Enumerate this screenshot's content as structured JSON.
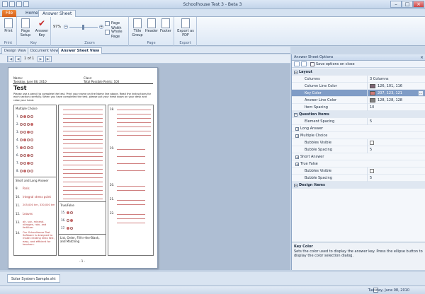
{
  "window": {
    "title": "Schoolhouse Test 3 - Beta 3"
  },
  "ribbon_tabs": [
    {
      "label": "File"
    },
    {
      "label": "Home"
    },
    {
      "label": "Answer Sheet"
    }
  ],
  "ribbon": {
    "groups": [
      {
        "label": "Print",
        "buttons": [
          "Print"
        ]
      },
      {
        "label": "Key",
        "buttons": [
          "Page Setup",
          "Answer Key"
        ]
      },
      {
        "label": "Zoom",
        "zoom_value": "97%",
        "buttons": [
          "Page Width",
          "Whole Page"
        ]
      },
      {
        "label": "Page",
        "buttons": [
          "Title Group",
          "Header",
          "Footer"
        ]
      },
      {
        "label": "Export",
        "buttons": [
          "Export as PDF"
        ]
      }
    ]
  },
  "view_tabs": [
    {
      "label": "Design View"
    },
    {
      "label": "Document View"
    },
    {
      "label": "Answer Sheet View"
    }
  ],
  "navigator": {
    "page_indicator": "1 of 1"
  },
  "paper": {
    "name_label": "Name:",
    "class_label": "Class:",
    "date": "Tuesday, June 08, 2010",
    "total_points": "Total Possible Points: 100",
    "title": "Test",
    "instructions": "Please use a pencil to complete the test. Print your name on the Name line above. Read the instructions for each section carefully. When you have completed the test, please put your head down on your desk and raise your hand.",
    "sections": {
      "multiple_choice": "Multiple Choice",
      "short_long": "Short and Long Answer",
      "true_false": "True/False",
      "list_order": "List, Order, Fill-in-the-Blank, and Matching"
    },
    "mc_numbers": [
      "1.",
      "2.",
      "3.",
      "4.",
      "5.",
      "6.",
      "7.",
      "8."
    ],
    "short_numbers": [
      "9.",
      "10.",
      "11.",
      "12.",
      "13.",
      "14."
    ],
    "short_answers": [
      "Paris",
      "integral stress point",
      "205,000 km, 330,000 km",
      "Leaves",
      "air, sun, mineral, nitrogen, rain, and fertilizer",
      "Our Schoolhouse Test Software is designed to make creating tests fast, easy, and efficient for teachers."
    ],
    "tf_numbers": [
      "15.",
      "16.",
      "17."
    ],
    "right_numbers": [
      "18.",
      "19.",
      "20.",
      "21.",
      "22."
    ],
    "page_footer": "- 1 -"
  },
  "properties": {
    "panel_title": "Answer Sheet Options",
    "save_on_close": "Save options on close",
    "rows": [
      {
        "kind": "cat",
        "name": "Layout"
      },
      {
        "kind": "prop",
        "name": "Columns",
        "value": "3 Columns"
      },
      {
        "kind": "prop",
        "name": "Column Line Color",
        "value": "126, 101, 116",
        "swatch": "#7e6574"
      },
      {
        "kind": "prop",
        "name": "Key Color",
        "value": "207, 123, 121",
        "swatch": "#cf7b79",
        "selected": true
      },
      {
        "kind": "prop",
        "name": "Answer Line Color",
        "value": "128, 128, 128",
        "swatch": "#808080"
      },
      {
        "kind": "prop",
        "name": "Item Spacing",
        "value": "10"
      },
      {
        "kind": "cat",
        "name": "Question Items"
      },
      {
        "kind": "prop",
        "name": "Element Spacing",
        "value": "5"
      },
      {
        "kind": "sub",
        "name": "Long Answer"
      },
      {
        "kind": "sub",
        "name": "Multiple Choice"
      },
      {
        "kind": "prop",
        "name": "Bubbles Visible",
        "value": "",
        "checkbox": true
      },
      {
        "kind": "prop",
        "name": "Bubble Spacing",
        "value": "5"
      },
      {
        "kind": "sub",
        "name": "Short Answer"
      },
      {
        "kind": "sub",
        "name": "True False"
      },
      {
        "kind": "prop",
        "name": "Bubbles Visible",
        "value": "",
        "checkbox": true
      },
      {
        "kind": "prop",
        "name": "Bubble Spacing",
        "value": "5"
      },
      {
        "kind": "cat",
        "name": "Design Items"
      }
    ],
    "help_title": "Key Color",
    "help_text": "Sets the color used to display the answer key. Press the ellipse button to display the color selection dialog."
  },
  "document_tab": {
    "label": "Solar System Sample.sht"
  },
  "status": {
    "date": "Tuesday, June 08, 2010"
  }
}
